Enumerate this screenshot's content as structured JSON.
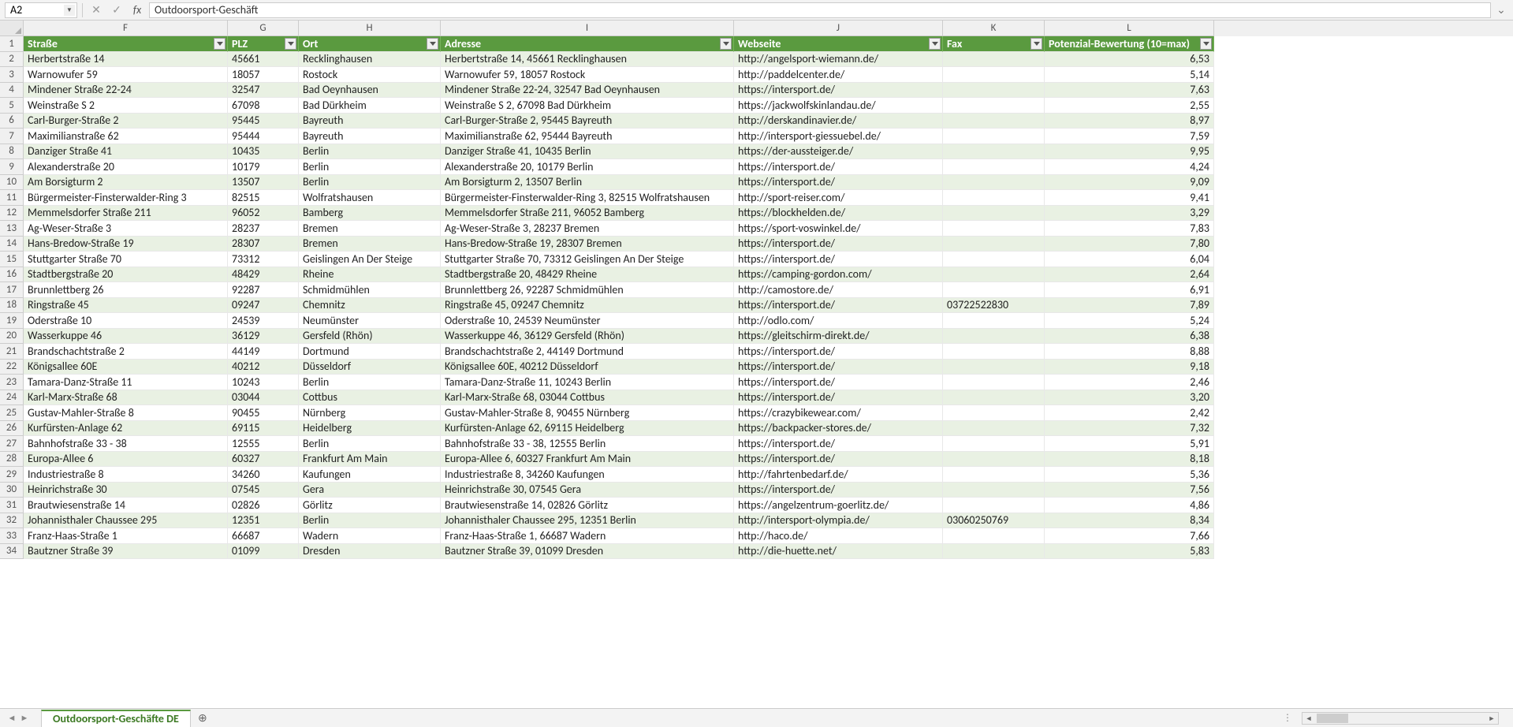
{
  "nameBox": "A2",
  "formulaValue": "Outdoorsport-Geschäft",
  "sheetTab": "Outdoorsport-Geschäfte DE",
  "colLetters": [
    "F",
    "G",
    "H",
    "I",
    "J",
    "K",
    "L"
  ],
  "headers": [
    "Straße",
    "PLZ",
    "Ort",
    "Adresse",
    "Webseite",
    "Fax",
    "Potenzial-Bewertung (10=max)"
  ],
  "rows": [
    {
      "n": 2,
      "f": "Herbertstraße 14",
      "g": "45661",
      "h": "Recklinghausen",
      "i": "Herbertstraße 14, 45661 Recklinghausen",
      "j": "http://angelsport-wiemann.de/",
      "k": "",
      "l": "6,53"
    },
    {
      "n": 3,
      "f": "Warnowufer 59",
      "g": "18057",
      "h": "Rostock",
      "i": "Warnowufer 59, 18057 Rostock",
      "j": "http://paddelcenter.de/",
      "k": "",
      "l": "5,14"
    },
    {
      "n": 4,
      "f": "Mindener Straße 22-24",
      "g": "32547",
      "h": "Bad Oeynhausen",
      "i": "Mindener Straße 22-24, 32547 Bad Oeynhausen",
      "j": "https://intersport.de/",
      "k": "",
      "l": "7,63"
    },
    {
      "n": 5,
      "f": "Weinstraße S 2",
      "g": "67098",
      "h": "Bad Dürkheim",
      "i": "Weinstraße S 2, 67098 Bad Dürkheim",
      "j": "https://jackwolfskinlandau.de/",
      "k": "",
      "l": "2,55"
    },
    {
      "n": 6,
      "f": "Carl-Burger-Straße 2",
      "g": "95445",
      "h": "Bayreuth",
      "i": "Carl-Burger-Straße 2, 95445 Bayreuth",
      "j": "http://derskandinavier.de/",
      "k": "",
      "l": "8,97"
    },
    {
      "n": 7,
      "f": "Maximilianstraße 62",
      "g": "95444",
      "h": "Bayreuth",
      "i": "Maximilianstraße 62, 95444 Bayreuth",
      "j": "http://intersport-giessuebel.de/",
      "k": "",
      "l": "7,59"
    },
    {
      "n": 8,
      "f": "Danziger Straße 41",
      "g": "10435",
      "h": "Berlin",
      "i": "Danziger Straße 41, 10435 Berlin",
      "j": "https://der-aussteiger.de/",
      "k": "",
      "l": "9,95"
    },
    {
      "n": 9,
      "f": "Alexanderstraße 20",
      "g": "10179",
      "h": "Berlin",
      "i": "Alexanderstraße 20, 10179 Berlin",
      "j": "https://intersport.de/",
      "k": "",
      "l": "4,24"
    },
    {
      "n": 10,
      "f": "Am Borsigturm 2",
      "g": "13507",
      "h": "Berlin",
      "i": "Am Borsigturm 2, 13507 Berlin",
      "j": "https://intersport.de/",
      "k": "",
      "l": "9,09"
    },
    {
      "n": 11,
      "f": "Bürgermeister-Finsterwalder-Ring 3",
      "g": "82515",
      "h": "Wolfratshausen",
      "i": "Bürgermeister-Finsterwalder-Ring 3, 82515 Wolfratshausen",
      "j": "http://sport-reiser.com/",
      "k": "",
      "l": "9,41"
    },
    {
      "n": 12,
      "f": "Memmelsdorfer Straße 211",
      "g": "96052",
      "h": "Bamberg",
      "i": "Memmelsdorfer Straße 211, 96052 Bamberg",
      "j": "https://blockhelden.de/",
      "k": "",
      "l": "3,29"
    },
    {
      "n": 13,
      "f": "Ag-Weser-Straße 3",
      "g": "28237",
      "h": "Bremen",
      "i": "Ag-Weser-Straße 3, 28237 Bremen",
      "j": "https://sport-voswinkel.de/",
      "k": "",
      "l": "7,83"
    },
    {
      "n": 14,
      "f": "Hans-Bredow-Straße 19",
      "g": "28307",
      "h": "Bremen",
      "i": "Hans-Bredow-Straße 19, 28307 Bremen",
      "j": "https://intersport.de/",
      "k": "",
      "l": "7,80"
    },
    {
      "n": 15,
      "f": "Stuttgarter Straße 70",
      "g": "73312",
      "h": "Geislingen An Der Steige",
      "i": "Stuttgarter Straße 70, 73312 Geislingen An Der Steige",
      "j": "https://intersport.de/",
      "k": "",
      "l": "6,04"
    },
    {
      "n": 16,
      "f": "Stadtbergstraße 20",
      "g": "48429",
      "h": "Rheine",
      "i": "Stadtbergstraße 20, 48429 Rheine",
      "j": "https://camping-gordon.com/",
      "k": "",
      "l": "2,64"
    },
    {
      "n": 17,
      "f": "Brunnlettberg 26",
      "g": "92287",
      "h": "Schmidmühlen",
      "i": "Brunnlettberg 26, 92287 Schmidmühlen",
      "j": "http://camostore.de/",
      "k": "",
      "l": "6,91"
    },
    {
      "n": 18,
      "f": "Ringstraße 45",
      "g": "09247",
      "h": "Chemnitz",
      "i": "Ringstraße 45, 09247 Chemnitz",
      "j": "https://intersport.de/",
      "k": "03722522830",
      "l": "7,89"
    },
    {
      "n": 19,
      "f": "Oderstraße 10",
      "g": "24539",
      "h": "Neumünster",
      "i": "Oderstraße 10, 24539 Neumünster",
      "j": "http://odlo.com/",
      "k": "",
      "l": "5,24"
    },
    {
      "n": 20,
      "f": "Wasserkuppe 46",
      "g": "36129",
      "h": "Gersfeld (Rhön)",
      "i": "Wasserkuppe 46, 36129 Gersfeld (Rhön)",
      "j": "https://gleitschirm-direkt.de/",
      "k": "",
      "l": "6,38"
    },
    {
      "n": 21,
      "f": "Brandschachtstraße 2",
      "g": "44149",
      "h": "Dortmund",
      "i": "Brandschachtstraße 2, 44149 Dortmund",
      "j": "https://intersport.de/",
      "k": "",
      "l": "8,88"
    },
    {
      "n": 22,
      "f": "Königsallee 60E",
      "g": "40212",
      "h": "Düsseldorf",
      "i": "Königsallee 60E, 40212 Düsseldorf",
      "j": "https://intersport.de/",
      "k": "",
      "l": "9,18"
    },
    {
      "n": 23,
      "f": "Tamara-Danz-Straße 11",
      "g": "10243",
      "h": "Berlin",
      "i": "Tamara-Danz-Straße 11, 10243 Berlin",
      "j": "https://intersport.de/",
      "k": "",
      "l": "2,46"
    },
    {
      "n": 24,
      "f": "Karl-Marx-Straße 68",
      "g": "03044",
      "h": "Cottbus",
      "i": "Karl-Marx-Straße 68, 03044 Cottbus",
      "j": "https://intersport.de/",
      "k": "",
      "l": "3,20"
    },
    {
      "n": 25,
      "f": "Gustav-Mahler-Straße 8",
      "g": "90455",
      "h": "Nürnberg",
      "i": "Gustav-Mahler-Straße 8, 90455 Nürnberg",
      "j": "https://crazybikewear.com/",
      "k": "",
      "l": "2,42"
    },
    {
      "n": 26,
      "f": "Kurfürsten-Anlage 62",
      "g": "69115",
      "h": "Heidelberg",
      "i": "Kurfürsten-Anlage 62, 69115 Heidelberg",
      "j": "https://backpacker-stores.de/",
      "k": "",
      "l": "7,32"
    },
    {
      "n": 27,
      "f": "Bahnhofstraße 33 - 38",
      "g": "12555",
      "h": "Berlin",
      "i": "Bahnhofstraße 33 - 38, 12555 Berlin",
      "j": "https://intersport.de/",
      "k": "",
      "l": "5,91"
    },
    {
      "n": 28,
      "f": "Europa-Allee 6",
      "g": "60327",
      "h": "Frankfurt Am Main",
      "i": "Europa-Allee 6, 60327 Frankfurt Am Main",
      "j": "https://intersport.de/",
      "k": "",
      "l": "8,18"
    },
    {
      "n": 29,
      "f": "Industriestraße 8",
      "g": "34260",
      "h": "Kaufungen",
      "i": "Industriestraße 8, 34260 Kaufungen",
      "j": "http://fahrtenbedarf.de/",
      "k": "",
      "l": "5,36"
    },
    {
      "n": 30,
      "f": "Heinrichstraße 30",
      "g": "07545",
      "h": "Gera",
      "i": "Heinrichstraße 30, 07545 Gera",
      "j": "https://intersport.de/",
      "k": "",
      "l": "7,56"
    },
    {
      "n": 31,
      "f": "Brautwiesenstraße 14",
      "g": "02826",
      "h": "Görlitz",
      "i": "Brautwiesenstraße 14, 02826 Görlitz",
      "j": "https://angelzentrum-goerlitz.de/",
      "k": "",
      "l": "4,86"
    },
    {
      "n": 32,
      "f": "Johannisthaler Chaussee 295",
      "g": "12351",
      "h": "Berlin",
      "i": "Johannisthaler Chaussee 295, 12351 Berlin",
      "j": "http://intersport-olympia.de/",
      "k": "03060250769",
      "l": "8,34"
    },
    {
      "n": 33,
      "f": "Franz-Haas-Straße 1",
      "g": "66687",
      "h": "Wadern",
      "i": "Franz-Haas-Straße 1, 66687 Wadern",
      "j": "http://haco.de/",
      "k": "",
      "l": "7,66"
    },
    {
      "n": 34,
      "f": "Bautzner Straße 39",
      "g": "01099",
      "h": "Dresden",
      "i": "Bautzner Straße 39, 01099 Dresden",
      "j": "http://die-huette.net/",
      "k": "",
      "l": "5,83"
    }
  ]
}
